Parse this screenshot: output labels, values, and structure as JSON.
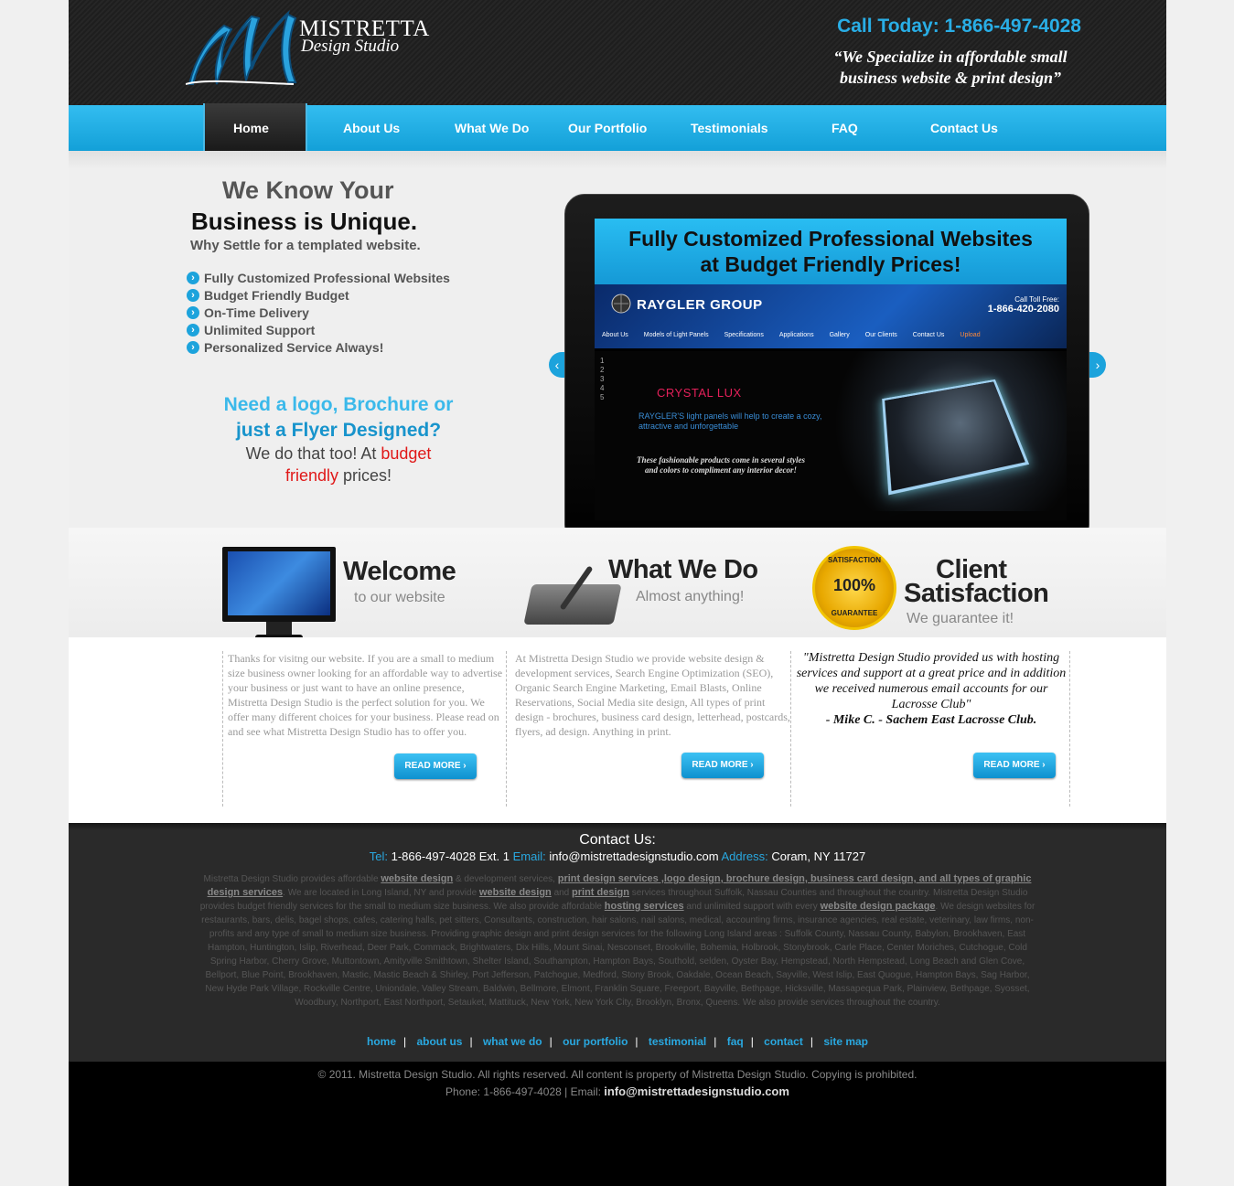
{
  "header": {
    "logo_title": "MISTRETTA",
    "logo_subtitle": "Design Studio",
    "phone": "Call Today: 1-866-497-4028",
    "tagline": "“We Specialize in affordable small business website & print design”"
  },
  "nav": {
    "items": [
      "Home",
      "About Us",
      "What We Do",
      "Our Portfolio",
      "Testimonials",
      "FAQ",
      "Contact Us"
    ],
    "active": "Home"
  },
  "hero": {
    "heading1": "We Know Your",
    "heading2": "Business is Unique.",
    "subheading": "Why Settle for a templated website.",
    "features": [
      "Fully Customized Professional Websites",
      "Budget Friendly Budget",
      "On-Time Delivery",
      "Unlimited Support",
      "Personalized Service Always!"
    ],
    "promo_line1": "Need a logo, Brochure or",
    "promo_line2": "just a Flyer Designed?",
    "promo_line3a": "We do that too! At ",
    "promo_budget": "budget",
    "promo_friendly": "friendly",
    "promo_line3b": " prices!"
  },
  "slider": {
    "banner_line1": "Fully Customized Professional Websites",
    "banner_line2": "at Budget Friendly Prices!",
    "brand": "RAYGLER GROUP",
    "call_label": "Call Toll Free:",
    "call_number": "1-866-420-2080",
    "nav": [
      "About Us",
      "Models of Light Panels",
      "Specifications",
      "Applications",
      "Gallery",
      "Our Clients",
      "Contact Us",
      "Upload"
    ],
    "nums": [
      "1",
      "2",
      "3",
      "4",
      "5"
    ],
    "product": "CRYSTAL LUX",
    "desc1": "RAYGLER'S light panels will help to create a cozy, attractive and unforgettable",
    "desc2": "These fashionable products come in several styles and colors to compliment any interior decor!",
    "dots": 4,
    "active_dot": 1
  },
  "band": {
    "welcome_title": "Welcome",
    "welcome_sub": "to our website",
    "whatwedo_title": "What We Do",
    "whatwedo_sub": "Almost anything!",
    "client_title1": "Client",
    "client_title2": "Satisfaction",
    "client_sub": "We  guarantee it!",
    "badge_top": "SATISFACTION",
    "badge_mid": "100%",
    "badge_bottom": "GUARANTEE"
  },
  "columns": {
    "welcome_text": "Thanks for visitng our website. If you are a small to medium size business owner looking for an affordable way to advertise your business or just want to have an online presence, Mistretta Design Studio is the perfect solution for you. We offer many different choices for your business. Please read on and see what Mistretta Design Studio has to offer you.",
    "whatwedo_text": "At Mistretta Design Studio we provide website design & development services, Search Engine Optimization (SEO), Organic Search Engine Marketing, Email Blasts, Online Reservations, Social Media site design, All types of print design - brochures, business card design, letterhead, postcards, flyers, ad design. Anything in print.",
    "quote": "\"Mistretta Design Studio provided us with hosting services and support at a great price and in addition we received numerous email accounts for our Lacrosse Club\"",
    "quote_author": "- Mike C. - Sachem East Lacrosse Club.",
    "read_more": "READ MORE"
  },
  "footer": {
    "contact_heading": "Contact Us:",
    "tel_label": "Tel:",
    "tel": "1-866-497-4028 Ext. 1",
    "email_label": "Email:",
    "email": "info@mistrettadesignstudio.com",
    "address_label": "Address:",
    "address": "Coram, NY 11727",
    "seo_1": "Mistretta Design Studio provides affordable",
    "seo_2": "website design",
    "seo_3": "& development services,",
    "seo_4": "print design services ,logo design, brochure design, business card design, and all types of graphic design services",
    "seo_5": ". We are located in Long Island, NY and provide",
    "seo_6": "website design",
    "seo_7": "and",
    "seo_8": "print design",
    "seo_9": "services throughout Suffolk, Nassau Counties and throughout the country. Mistretta Design Studio provides budget friendly services for the small to medium size business. We also provide affordable",
    "seo_10": "hosting services",
    "seo_11": "and unlimited support with every",
    "seo_12": "website design package",
    "seo_13": ". We design websites for restaurants, bars, delis, bagel shops, cafes, catering halls, pet sitters, Consultants, construction, hair salons, nail salons, medical, accounting firms, insurance agencies, real estate, veterinary, law firms, non-profits and any type of small to medium size business. Providing graphic design and print design services for the following Long Island areas : Suffolk County, Nassau County, Babylon, Brookhaven, East Hampton, Huntington, Islip, Riverhead, Deer Park, Commack, Brightwaters, Dix Hills, Mount Sinai, Nesconset, Brookville, Bohemia, Holbrook, Stonybrook, Carle Place, Center Moriches, Cutchogue, Cold Spring Harbor, Cherry Grove, Muttontown, Amityville Smithtown, Shelter Island, Southampton, Hampton Bays, Southold, selden, Oyster Bay, Hempstead, North Hempstead, Long Beach and Glen Cove, Bellport, Blue Point, Brookhaven, Mastic, Mastic Beach & Shirley, Port Jefferson, Patchogue, Medford, Stony Brook, Oakdale, Ocean Beach, Sayville, West Islip, East Quogue, Hampton Bays, Sag Harbor, New Hyde Park Village, Rockville Centre, Uniondale, Valley Stream, Baldwin, Bellmore, Elmont, Franklin Square, Freeport, Bayville, Bethpage, Hicksville, Massapequa Park, Plainview, Bethpage, Syosset, Woodbury, Northport, East Northport, Setauket, Mattituck, New York, New York City, Brooklyn, Bronx, Queens. We also provide services throughout the country.",
    "links": [
      "home",
      "about us",
      "what we do",
      "our portfolio",
      "testimonial",
      "faq",
      "contact",
      "site map"
    ],
    "copyright": "© 2011. Mistretta Design Studio. All rights reserved. All content is property of Mistretta Design Studio. Copying is prohibited.",
    "phone_email_prefix": "Phone: 1-866-497-4028 | Email:",
    "bottom_email": "info@mistrettadesignstudio.com"
  },
  "colors": {
    "accent": "#1ca3dc",
    "header_bg": "#222222",
    "footer_bg": "#2a2a2a",
    "highlight_red": "#e01818"
  }
}
